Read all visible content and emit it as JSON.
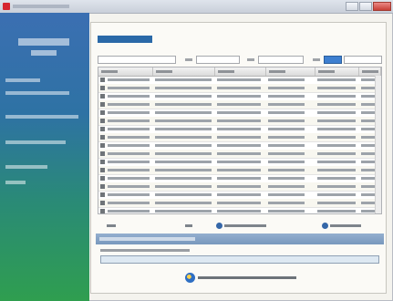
{
  "window": {
    "title": ""
  },
  "sidebar": {
    "title": "",
    "subtitle": "",
    "items": [
      {
        "label": ""
      },
      {
        "label": ""
      },
      {
        "label": ""
      },
      {
        "label": ""
      },
      {
        "label": ""
      },
      {
        "label": ""
      }
    ]
  },
  "main": {
    "panel_title": "",
    "filters": [
      {
        "label": "",
        "value": ""
      },
      {
        "label": "",
        "value": ""
      },
      {
        "label": "",
        "value": ""
      },
      {
        "label": "",
        "value": ""
      }
    ],
    "table": {
      "columns": [
        "",
        "",
        "",
        "",
        "",
        ""
      ],
      "rows": [
        [
          "",
          "",
          "",
          "",
          "",
          ""
        ],
        [
          "",
          "",
          "",
          "",
          "",
          ""
        ],
        [
          "",
          "",
          "",
          "",
          "",
          ""
        ],
        [
          "",
          "",
          "",
          "",
          "",
          ""
        ],
        [
          "",
          "",
          "",
          "",
          "",
          ""
        ],
        [
          "",
          "",
          "",
          "",
          "",
          ""
        ],
        [
          "",
          "",
          "",
          "",
          "",
          ""
        ],
        [
          "",
          "",
          "",
          "",
          "",
          ""
        ],
        [
          "",
          "",
          "",
          "",
          "",
          ""
        ],
        [
          "",
          "",
          "",
          "",
          "",
          ""
        ],
        [
          "",
          "",
          "",
          "",
          "",
          ""
        ],
        [
          "",
          "",
          "",
          "",
          "",
          ""
        ],
        [
          "",
          "",
          "",
          "",
          "",
          ""
        ],
        [
          "",
          "",
          "",
          "",
          "",
          ""
        ],
        [
          "",
          "",
          "",
          "",
          "",
          ""
        ],
        [
          "",
          "",
          "",
          "",
          "",
          ""
        ],
        [
          "",
          "",
          "",
          "",
          "",
          ""
        ]
      ]
    },
    "pager": {
      "prev": "",
      "page": "",
      "select_all": "",
      "select_none": ""
    },
    "stage": {
      "title": "",
      "status": "",
      "progress_fraction": 0.0,
      "start_label": ""
    }
  },
  "colors": {
    "sidebar_top": "#3b6fb2",
    "sidebar_bottom": "#2f9e4f",
    "accent": "#2a69a8",
    "close_button": "#c83f36"
  },
  "icons": {
    "app": "app-icon",
    "prev": "arrow-left-icon",
    "select_all": "check-circle-icon",
    "select_none": "cross-circle-icon",
    "start": "run-icon"
  }
}
